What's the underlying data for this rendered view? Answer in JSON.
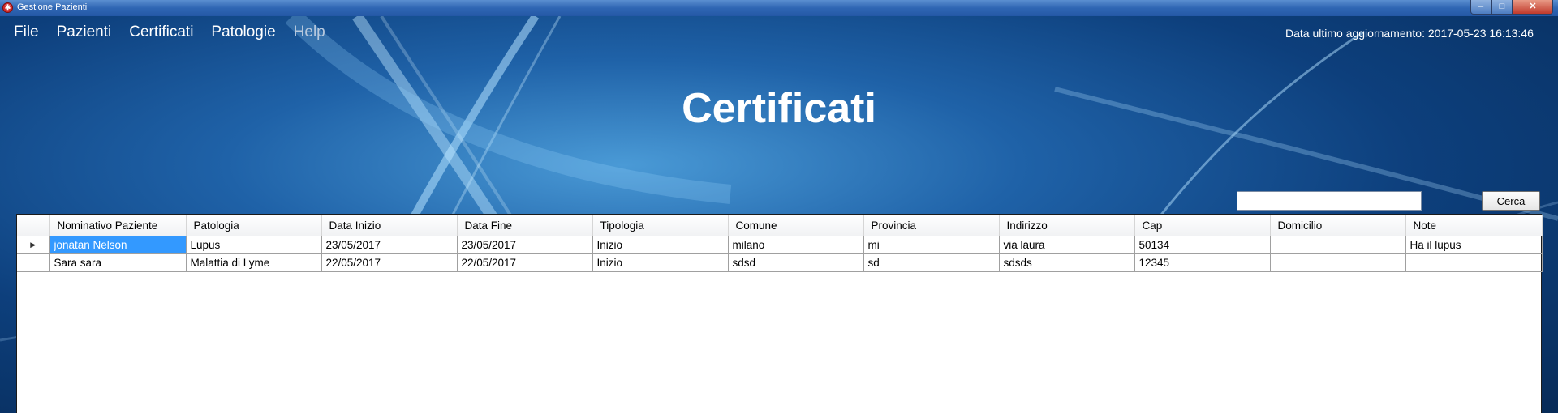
{
  "window": {
    "title": "Gestione Pazienti",
    "app_icon": "red-medical-icon",
    "controls": {
      "minimize": "–",
      "maximize": "□",
      "close": "✕"
    }
  },
  "menu": {
    "items": [
      {
        "label": "File",
        "enabled": true
      },
      {
        "label": "Pazienti",
        "enabled": true
      },
      {
        "label": "Certificati",
        "enabled": true
      },
      {
        "label": "Patologie",
        "enabled": true
      },
      {
        "label": "Help",
        "enabled": false
      }
    ]
  },
  "status": {
    "last_update": "Data ultimo aggiornamento: 2017-05-23 16:13:46"
  },
  "page": {
    "title": "Certificati"
  },
  "search": {
    "value": "",
    "placeholder": "",
    "button_label": "Cerca"
  },
  "colors": {
    "selection": "#3399ff",
    "background": "#0d3f7c"
  },
  "table": {
    "columns": [
      "Nominativo Paziente",
      "Patologia",
      "Data Inizio",
      "Data Fine",
      "Tipologia",
      "Comune",
      "Provincia",
      "Indirizzo",
      "Cap",
      "Domicilio",
      "Note"
    ],
    "rows": [
      {
        "indicator": "▶",
        "cells": [
          "jonatan Nelson",
          "Lupus",
          "23/05/2017",
          "23/05/2017",
          "Inizio",
          "milano",
          "mi",
          "via laura",
          "50134",
          "",
          "Ha il lupus"
        ]
      },
      {
        "indicator": "",
        "cells": [
          "Sara sara",
          "Malattia di Lyme",
          "22/05/2017",
          "22/05/2017",
          "Inizio",
          "sdsd",
          "sd",
          "sdsds",
          "12345",
          "",
          ""
        ]
      }
    ]
  }
}
